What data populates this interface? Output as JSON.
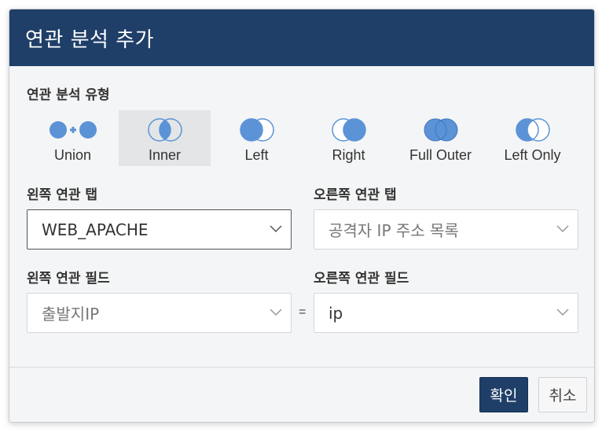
{
  "dialog": {
    "title": "연관 분석 추가",
    "type_label": "연관 분석 유형",
    "types": [
      {
        "label": "Union",
        "icon": "union-icon"
      },
      {
        "label": "Inner",
        "icon": "inner-join-icon",
        "selected": true
      },
      {
        "label": "Left",
        "icon": "left-join-icon"
      },
      {
        "label": "Right",
        "icon": "right-join-icon"
      },
      {
        "label": "Full Outer",
        "icon": "full-outer-join-icon"
      },
      {
        "label": "Left Only",
        "icon": "left-only-join-icon"
      }
    ],
    "left_tab_label": "왼쪽 연관 탭",
    "left_tab_value": "WEB_APACHE",
    "right_tab_label": "오른쪽 연관 탭",
    "right_tab_placeholder": "공격자 IP 주소 목록",
    "left_field_label": "왼쪽 연관 필드",
    "left_field_placeholder": "출발지IP",
    "equals": "=",
    "right_field_label": "오른쪽 연관 필드",
    "right_field_value": "ip",
    "confirm_label": "확인",
    "cancel_label": "취소"
  },
  "colors": {
    "header": "#1f3f68",
    "circle_fill": "#5b93d6",
    "selected_bg": "#e3e5e7"
  }
}
